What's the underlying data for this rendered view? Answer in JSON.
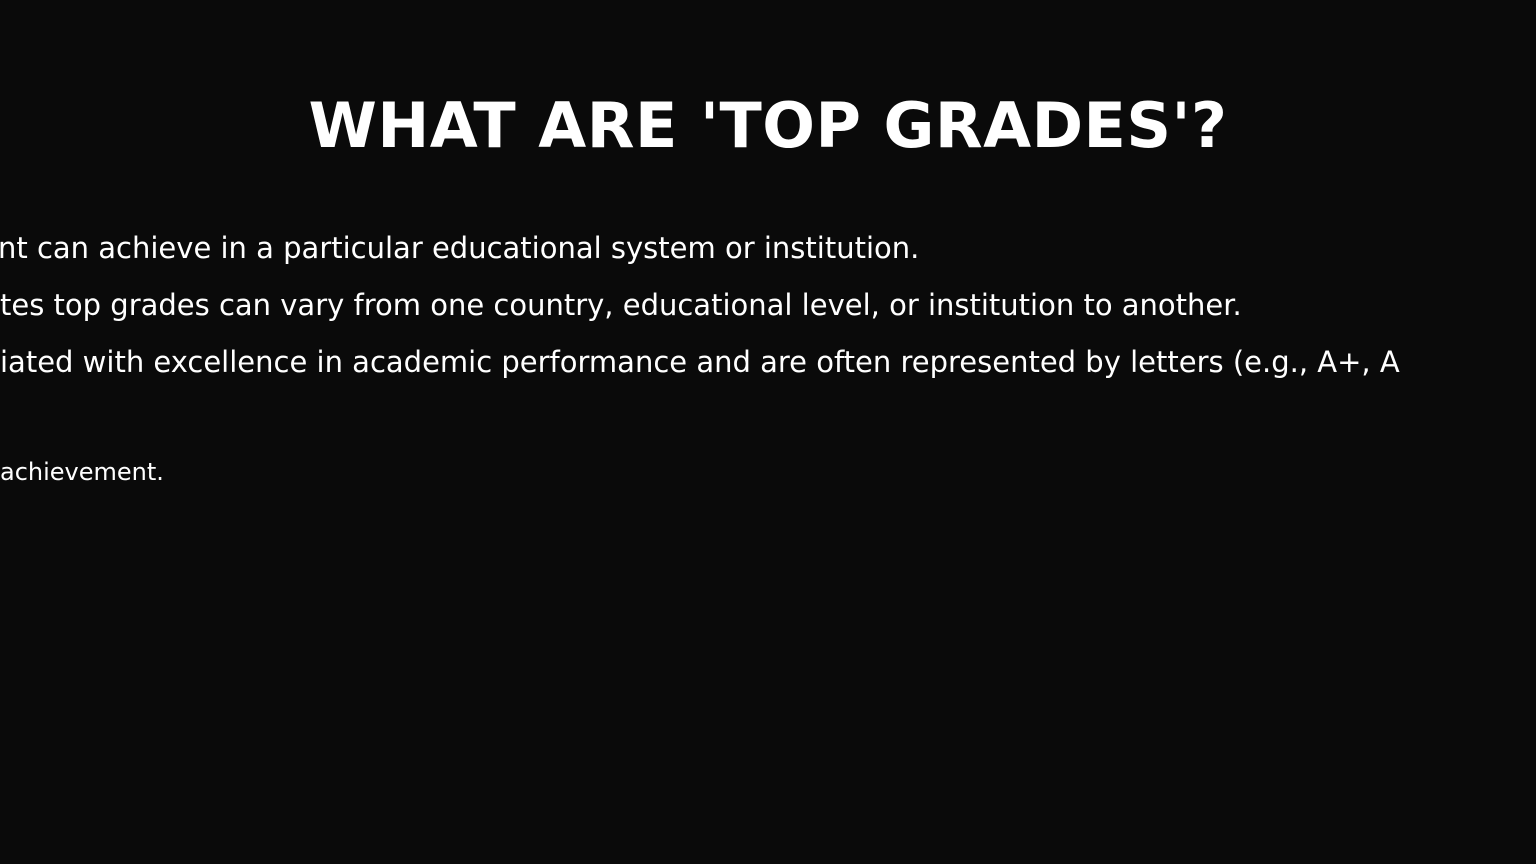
{
  "slide": {
    "title": "WHAT ARE 'TOP GRADES'?",
    "lines": [
      "nt can achieve in a particular educational system or institution.",
      "tes top grades can vary from one country, educational level, or institution to another.",
      "iated with excellence in academic performance and are often represented by letters (e.g., A+, A",
      "achievement."
    ]
  }
}
